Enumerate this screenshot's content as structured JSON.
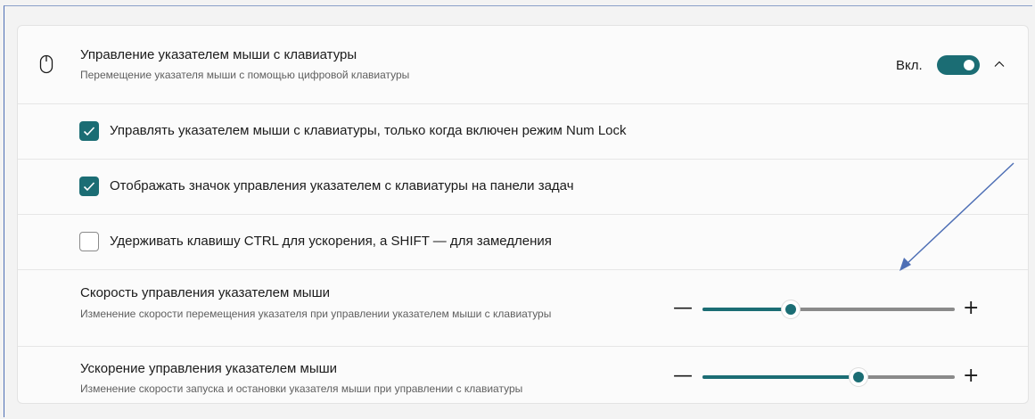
{
  "header": {
    "title": "Управление указателем мыши с клавиатуры",
    "subtitle": "Перемещение указателя мыши с помощью цифровой клавиатуры",
    "toggle_state_label": "Вкл.",
    "toggle_on": true,
    "icon": "mouse-icon",
    "expand_icon": "chevron-up-icon"
  },
  "options": [
    {
      "label": "Управлять указателем мыши с клавиатуры, только когда включен режим Num Lock",
      "checked": true
    },
    {
      "label": "Отображать значок управления указателем с клавиатуры на панели задач",
      "checked": true
    },
    {
      "label": "Удерживать клавишу CTRL для ускорения, а SHIFT — для замедления",
      "checked": false
    }
  ],
  "sliders": [
    {
      "title": "Скорость управления указателем мыши",
      "subtitle": "Изменение скорости перемещения указателя при управлении указателем мыши с клавиатуры",
      "value": 0.35,
      "minus": "—",
      "plus": "+"
    },
    {
      "title": "Ускорение управления указателем мыши",
      "subtitle": "Изменение скорости запуска и остановки указателя мыши при управлении с клавиатуры",
      "value": 0.62,
      "minus": "—",
      "plus": "+"
    }
  ],
  "colors": {
    "accent": "#1b6d74",
    "annotation_arrow": "#4e6fb5",
    "track": "#8a8a8a"
  }
}
